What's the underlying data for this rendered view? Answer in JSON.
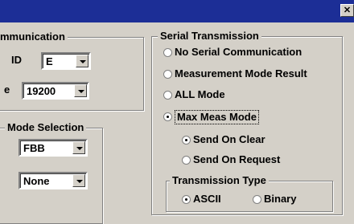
{
  "window": {
    "close_glyph": "✕"
  },
  "communication": {
    "legend": "mmunication",
    "id_label": "ID",
    "id_value": "E",
    "rate_label": "e",
    "rate_value": "19200"
  },
  "mode_selection": {
    "legend": "Mode Selection",
    "mode_value": "FBB",
    "second_value": "None"
  },
  "serial_transmission": {
    "legend": "Serial Transmission",
    "options": [
      {
        "label": "No Serial Communication",
        "checked": false
      },
      {
        "label": "Measurement Mode Result",
        "checked": false
      },
      {
        "label": "ALL Mode",
        "checked": false
      },
      {
        "label": "Max Meas Mode",
        "checked": true
      }
    ],
    "send_options": [
      {
        "label": "Send On Clear",
        "checked": true
      },
      {
        "label": "Send On Request",
        "checked": false
      }
    ]
  },
  "transmission_type": {
    "legend": "Transmission Type",
    "options": [
      {
        "label": "ASCII",
        "checked": true
      },
      {
        "label": "Binary",
        "checked": false
      }
    ]
  },
  "colors": {
    "titlebar": "#1c2e96",
    "face": "#d4d0c8"
  }
}
